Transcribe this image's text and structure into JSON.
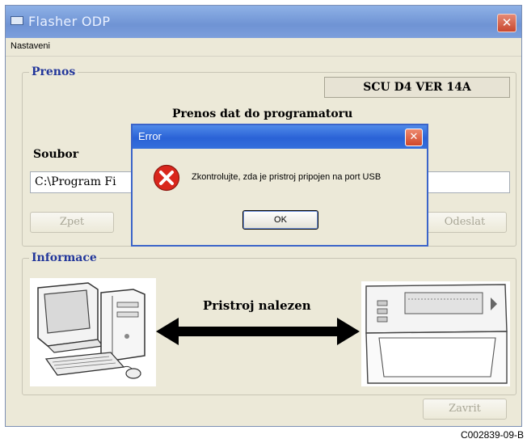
{
  "window": {
    "title": "Flasher ODP",
    "menu": [
      "Nastaveni"
    ]
  },
  "prenos": {
    "group_label": "Prenos",
    "version": "SCU D4 VER 14A",
    "heading": "Prenos dat do programatoru",
    "file_label": "Soubor",
    "file_path": "C:\\Program Fi",
    "buttons": {
      "back": "Zpet",
      "send": "Odeslat"
    }
  },
  "informace": {
    "group_label": "Informace",
    "status": "Pristroj nalezen"
  },
  "footer": {
    "close": "Zavrit"
  },
  "dialog": {
    "title": "Error",
    "message": "Zkontrolujte, zda je pristroj pripojen na port USB",
    "ok": "OK",
    "icon": "error-icon"
  },
  "caption": "C002839-09-B",
  "colors": {
    "title_bar": "#7c9fdc",
    "dialog_title_bar": "#2a62d6",
    "group_label": "#23379b",
    "error_red": "#d9261c"
  }
}
